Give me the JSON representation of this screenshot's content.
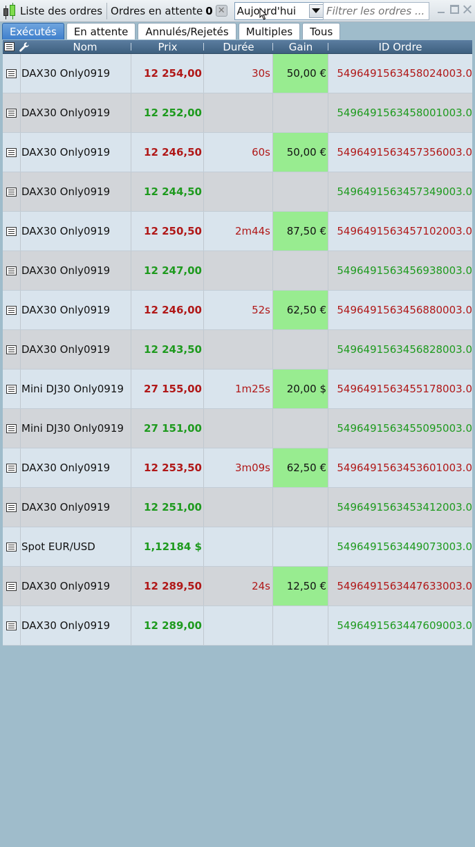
{
  "toolbar": {
    "title": "Liste des ordres",
    "pending_label": "Ordres en attente",
    "pending_count": "0",
    "period_value": "Aujourd'hui",
    "filter_placeholder": "Filtrer les ordres ..."
  },
  "tabs": [
    {
      "label": "Exécutés",
      "active": true
    },
    {
      "label": "En attente",
      "active": false
    },
    {
      "label": "Annulés/Rejetés",
      "active": false
    },
    {
      "label": "Multiples",
      "active": false
    },
    {
      "label": "Tous",
      "active": false
    }
  ],
  "columns": {
    "name": "Nom",
    "price": "Prix",
    "duration": "Durée",
    "gain": "Gain",
    "order_id": "ID Ordre"
  },
  "colors": {
    "sell": "#b01818",
    "buy": "#1e9a1e",
    "gain_bg": "#98ec90",
    "active_tab": "#3f7fcc"
  },
  "rows": [
    {
      "name": "DAX30 Only0919",
      "price": "12 254,00",
      "side": "sell",
      "duration": "30s",
      "gain": "50,00 €",
      "id": "5496491563458024003.0"
    },
    {
      "name": "DAX30 Only0919",
      "price": "12 252,00",
      "side": "buy",
      "duration": "",
      "gain": "",
      "id": "5496491563458001003.0"
    },
    {
      "name": "DAX30 Only0919",
      "price": "12 246,50",
      "side": "sell",
      "duration": "60s",
      "gain": "50,00 €",
      "id": "5496491563457356003.0"
    },
    {
      "name": "DAX30 Only0919",
      "price": "12 244,50",
      "side": "buy",
      "duration": "",
      "gain": "",
      "id": "5496491563457349003.0"
    },
    {
      "name": "DAX30 Only0919",
      "price": "12 250,50",
      "side": "sell",
      "duration": "2m44s",
      "gain": "87,50 €",
      "id": "5496491563457102003.0"
    },
    {
      "name": "DAX30 Only0919",
      "price": "12 247,00",
      "side": "buy",
      "duration": "",
      "gain": "",
      "id": "5496491563456938003.0"
    },
    {
      "name": "DAX30 Only0919",
      "price": "12 246,00",
      "side": "sell",
      "duration": "52s",
      "gain": "62,50 €",
      "id": "5496491563456880003.0"
    },
    {
      "name": "DAX30 Only0919",
      "price": "12 243,50",
      "side": "buy",
      "duration": "",
      "gain": "",
      "id": "5496491563456828003.0"
    },
    {
      "name": "Mini DJ30 Only0919",
      "price": "27 155,00",
      "side": "sell",
      "duration": "1m25s",
      "gain": "20,00 $",
      "id": "5496491563455178003.0"
    },
    {
      "name": "Mini DJ30 Only0919",
      "price": "27 151,00",
      "side": "buy",
      "duration": "",
      "gain": "",
      "id": "5496491563455095003.0"
    },
    {
      "name": "DAX30 Only0919",
      "price": "12 253,50",
      "side": "sell",
      "duration": "3m09s",
      "gain": "62,50 €",
      "id": "5496491563453601003.0"
    },
    {
      "name": "DAX30 Only0919",
      "price": "12 251,00",
      "side": "buy",
      "duration": "",
      "gain": "",
      "id": "5496491563453412003.0"
    },
    {
      "name": "Spot EUR/USD",
      "price": "1,12184 $",
      "side": "buy",
      "duration": "",
      "gain": "",
      "id": "5496491563449073003.0"
    },
    {
      "name": "DAX30 Only0919",
      "price": "12 289,50",
      "side": "sell",
      "duration": "24s",
      "gain": "12,50 €",
      "id": "5496491563447633003.0"
    },
    {
      "name": "DAX30 Only0919",
      "price": "12 289,00",
      "side": "buy",
      "duration": "",
      "gain": "",
      "id": "5496491563447609003.0"
    }
  ]
}
